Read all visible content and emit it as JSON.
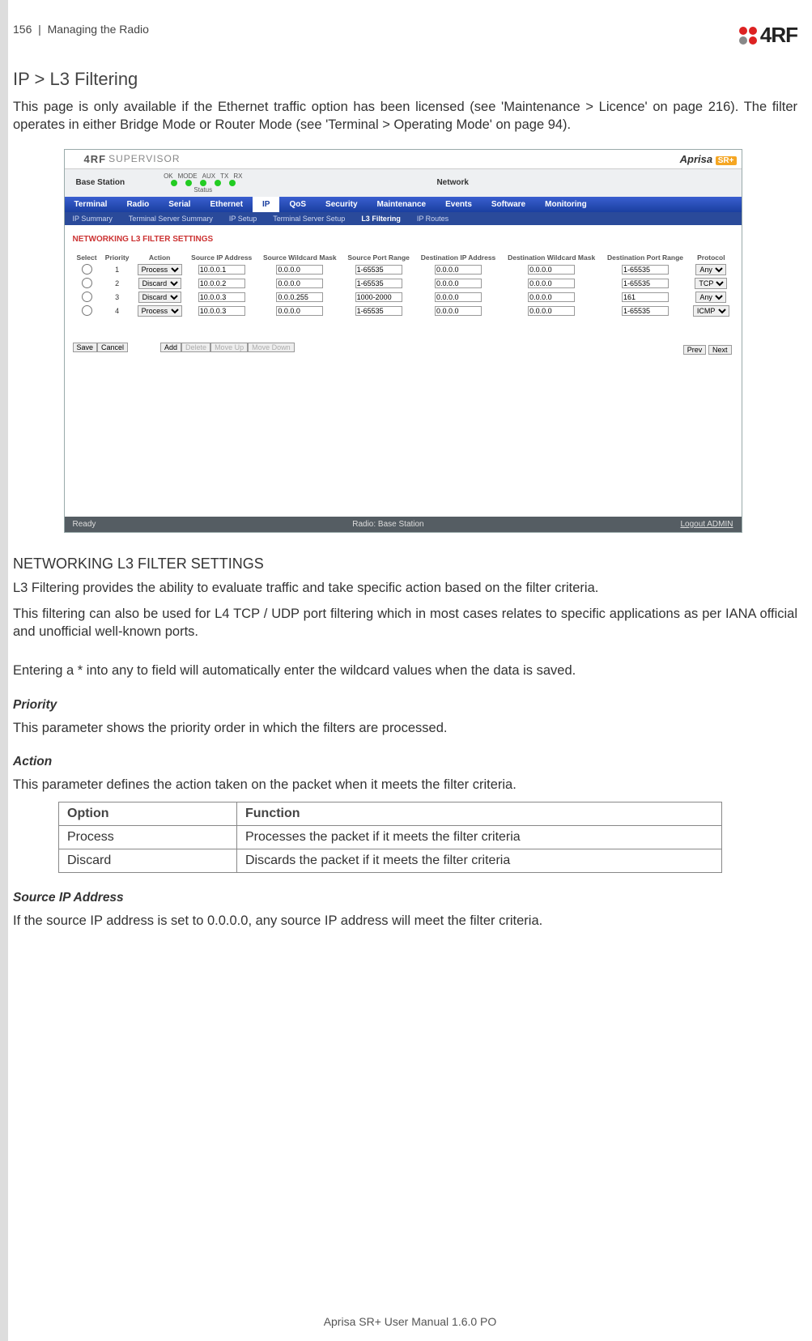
{
  "header": {
    "page_no": "156",
    "section": "Managing the Radio",
    "logo_text": "4RF"
  },
  "title": "IP > L3 Filtering",
  "intro": "This page is only available if the Ethernet traffic option has been licensed (see 'Maintenance > Licence' on page 216). The filter operates in either Bridge Mode or Router Mode (see 'Terminal > Operating Mode' on page 94).",
  "screenshot": {
    "supervisor": "SUPERVISOR",
    "aprisa": "Aprisa",
    "sr": "SR+",
    "base_station": "Base Station",
    "led_labels": [
      "OK",
      "MODE",
      "AUX",
      "TX",
      "RX"
    ],
    "status_label": "Status",
    "network": "Network",
    "nav": [
      "Terminal",
      "Radio",
      "Serial",
      "Ethernet",
      "IP",
      "QoS",
      "Security",
      "Maintenance",
      "Events",
      "Software",
      "Monitoring"
    ],
    "nav_active": "IP",
    "subnav": [
      "IP Summary",
      "Terminal Server Summary",
      "IP Setup",
      "Terminal Server Setup",
      "L3 Filtering",
      "IP Routes"
    ],
    "subnav_active": "L3 Filtering",
    "panel_title": "NETWORKING L3 FILTER SETTINGS",
    "columns": [
      "Select",
      "Priority",
      "Action",
      "Source IP Address",
      "Source Wildcard Mask",
      "Source Port Range",
      "Destination IP Address",
      "Destination Wildcard Mask",
      "Destination Port Range",
      "Protocol"
    ],
    "rows": [
      {
        "priority": "1",
        "action": "Process",
        "src_ip": "10.0.0.1",
        "src_mask": "0.0.0.0",
        "src_port": "1-65535",
        "dst_ip": "0.0.0.0",
        "dst_mask": "0.0.0.0",
        "dst_port": "1-65535",
        "proto": "Any"
      },
      {
        "priority": "2",
        "action": "Discard",
        "src_ip": "10.0.0.2",
        "src_mask": "0.0.0.0",
        "src_port": "1-65535",
        "dst_ip": "0.0.0.0",
        "dst_mask": "0.0.0.0",
        "dst_port": "1-65535",
        "proto": "TCP"
      },
      {
        "priority": "3",
        "action": "Discard",
        "src_ip": "10.0.0.3",
        "src_mask": "0.0.0.255",
        "src_port": "1000-2000",
        "dst_ip": "0.0.0.0",
        "dst_mask": "0.0.0.0",
        "dst_port": "161",
        "proto": "Any"
      },
      {
        "priority": "4",
        "action": "Process",
        "src_ip": "10.0.0.3",
        "src_mask": "0.0.0.0",
        "src_port": "1-65535",
        "dst_ip": "0.0.0.0",
        "dst_mask": "0.0.0.0",
        "dst_port": "1-65535",
        "proto": "ICMP"
      }
    ],
    "buttons": {
      "save": "Save",
      "cancel": "Cancel",
      "add": "Add",
      "delete": "Delete",
      "move_up": "Move Up",
      "move_down": "Move Down",
      "prev": "Prev",
      "next": "Next"
    },
    "footer": {
      "ready": "Ready",
      "radio": "Radio: Base Station",
      "logout": "Logout ADMIN"
    }
  },
  "sec_heading": "NETWORKING L3 FILTER SETTINGS",
  "para1": "L3 Filtering provides the ability to evaluate traffic and take specific action based on the filter criteria.",
  "para2": "This filtering can also be used for L4 TCP / UDP port filtering which in most cases relates to specific applications as per IANA official and unofficial well-known ports.",
  "para3": "Entering a * into any to field will automatically enter the wildcard values when the data is saved.",
  "priority_h": "Priority",
  "priority_p": "This parameter shows the priority order in which the filters are processed.",
  "action_h": "Action",
  "action_p": "This parameter defines the action taken on the packet when it meets the filter criteria.",
  "opt_table": {
    "h1": "Option",
    "h2": "Function",
    "r1c1": "Process",
    "r1c2": "Processes the packet if it meets the filter criteria",
    "r2c1": "Discard",
    "r2c2": "Discards the packet if it meets the filter criteria"
  },
  "srcip_h": "Source IP Address",
  "srcip_p": "If the source IP address is set to 0.0.0.0, any source IP address will meet the filter criteria.",
  "footer_text": "Aprisa SR+ User Manual 1.6.0 PO"
}
